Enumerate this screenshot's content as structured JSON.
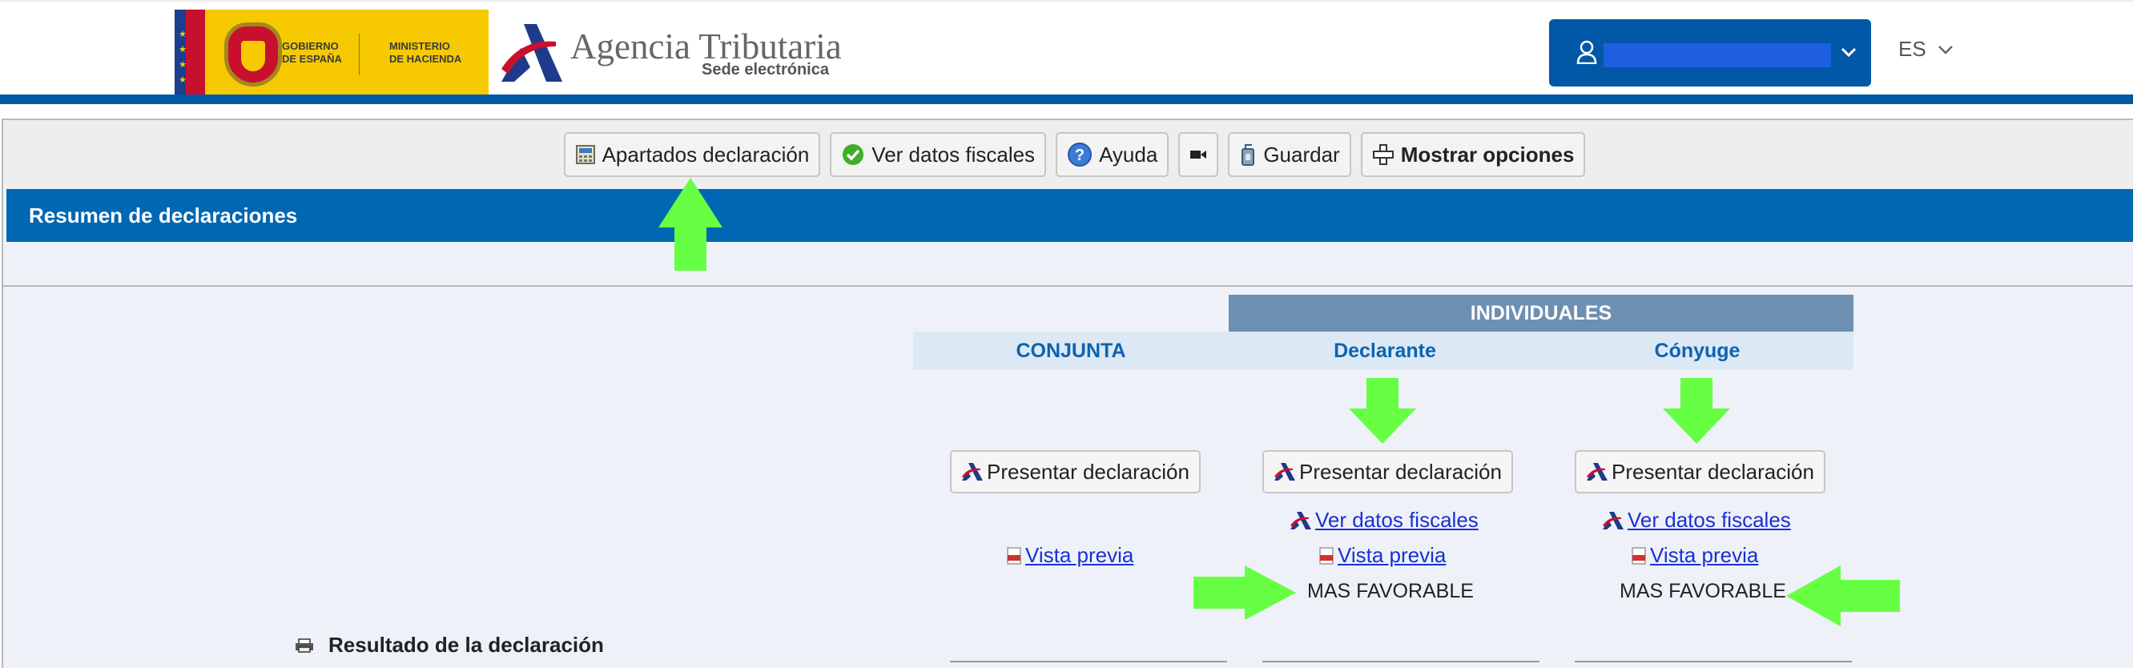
{
  "header": {
    "gobierno_text": "GOBIERNO\nDE ESPAÑA",
    "ministerio_text": "MINISTERIO\nDE HACIENDA",
    "agency_title": "Agencia Tributaria",
    "agency_subtitle": "Sede electrónica",
    "language": "ES"
  },
  "toolbar": {
    "apartados": "Apartados declaración",
    "ver_datos": "Ver datos fiscales",
    "ayuda": "Ayuda",
    "guardar": "Guardar",
    "mostrar": "Mostrar opciones"
  },
  "section": {
    "title": "Resumen de declaraciones"
  },
  "table": {
    "group_header": "INDIVIDUALES",
    "columns": {
      "conjunta": "CONJUNTA",
      "declarante": "Declarante",
      "conyuge": "Cónyuge"
    },
    "presentar": "Presentar declaración",
    "ver_datos": "Ver datos fiscales",
    "vista_previa": "Vista previa",
    "mas_favorable": "MAS FAVORABLE",
    "resultado": "Resultado de la declaración"
  },
  "colors": {
    "brand_blue": "#0058a6",
    "section_blue": "#0067b3",
    "annotation_arrow": "#66ff44"
  },
  "icons": [
    "user-icon",
    "chevron-down-icon",
    "calculator-icon",
    "check-circle-icon",
    "help-icon",
    "video-camera-icon",
    "save-icon",
    "expand-icon",
    "aeat-logo-icon",
    "pdf-icon",
    "printer-icon"
  ]
}
